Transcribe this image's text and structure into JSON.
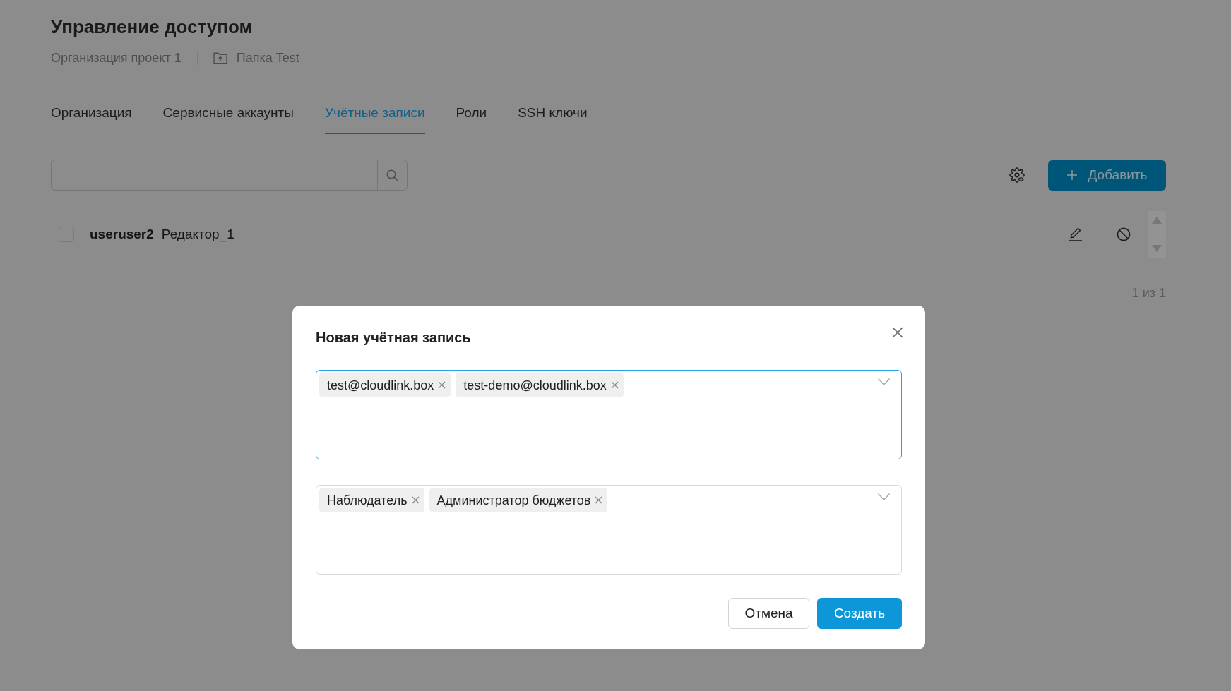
{
  "page": {
    "title": "Управление доступом",
    "breadcrumbs": [
      {
        "kind": "organization",
        "label": "Организация проект 1"
      },
      {
        "kind": "folder",
        "label": "Папка Test"
      }
    ]
  },
  "tabs": [
    {
      "label": "Организация",
      "selected": false
    },
    {
      "label": "Сервисные аккаунты",
      "selected": false
    },
    {
      "label": "Учётные записи",
      "selected": true
    },
    {
      "label": "Роли",
      "selected": false
    },
    {
      "label": "SSH ключи",
      "selected": false
    }
  ],
  "toolbar": {
    "add_button": "Добавить"
  },
  "table": {
    "rows": [
      {
        "name": "useruser2",
        "role": "Редактор_1",
        "checked": false
      }
    ]
  },
  "pagination": "1 из 1",
  "dialog": {
    "title": "Новая учётная запись",
    "users_field": {
      "focused": true,
      "tags": [
        "test@cloudlink.box",
        "test-demo@cloudlink.box"
      ]
    },
    "roles_field": {
      "focused": false,
      "tags": [
        "Наблюдатель",
        "Администратор бюджетов"
      ]
    },
    "buttons": [
      {
        "kind": "secondary",
        "label": "Отмена"
      },
      {
        "kind": "primary",
        "label": "Создать"
      }
    ]
  }
}
